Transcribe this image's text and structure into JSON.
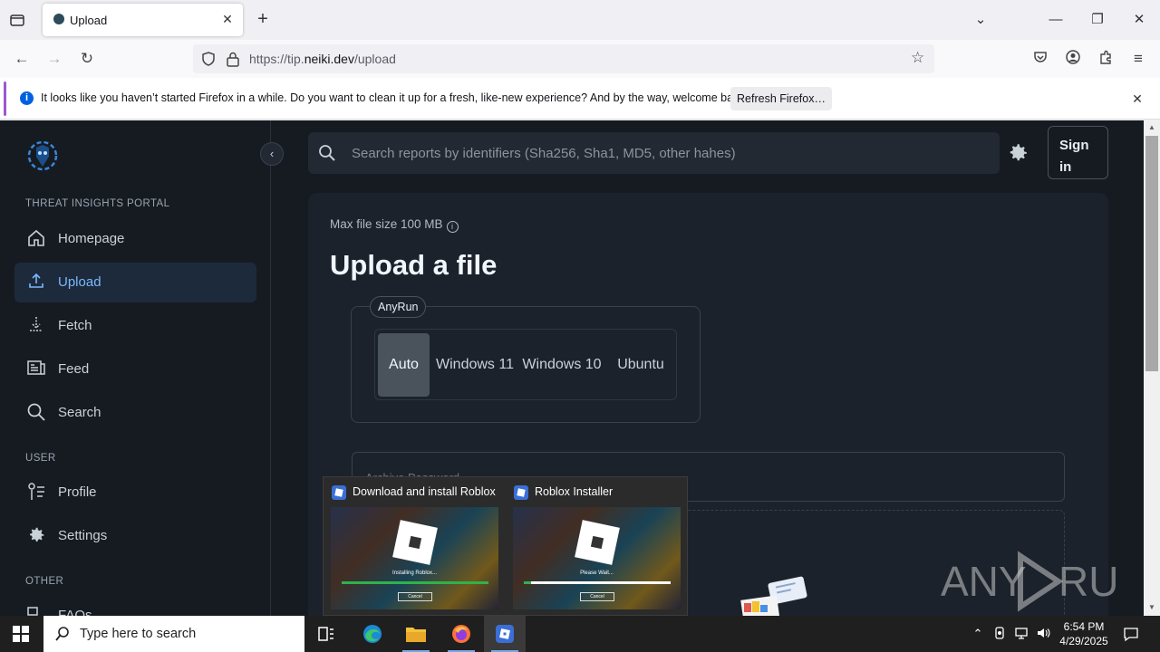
{
  "browser": {
    "tab_title": "Upload",
    "url_prefix": "https://tip.",
    "url_domain": "neiki.dev",
    "url_path": "/upload",
    "notification": {
      "message": "It looks like you haven’t started Firefox in a while. Do you want to clean it up for a fresh, like-new experience? And by the way, welcome back!",
      "button": "Refresh Firefox…"
    }
  },
  "sidebar": {
    "section_portal": "THREAT INSIGHTS PORTAL",
    "section_user": "USER",
    "section_other": "OTHER",
    "items": [
      {
        "label": "Homepage",
        "icon": "home-icon"
      },
      {
        "label": "Upload",
        "icon": "upload-icon"
      },
      {
        "label": "Fetch",
        "icon": "fetch-icon"
      },
      {
        "label": "Feed",
        "icon": "feed-icon"
      },
      {
        "label": "Search",
        "icon": "search-icon"
      },
      {
        "label": "Profile",
        "icon": "profile-icon"
      },
      {
        "label": "Settings",
        "icon": "gear-icon"
      },
      {
        "label": "FAQs",
        "icon": "faq-icon"
      }
    ],
    "active_item": "Upload"
  },
  "header": {
    "search_placeholder": "Search reports by identifiers (Sha256, Sha1, MD5, other hahes)",
    "sign_in": "Sign in"
  },
  "upload": {
    "max_size": "Max file size 100 MB",
    "title": "Upload a file",
    "sandbox_legend": "AnyRun",
    "os_options": [
      "Auto",
      "Windows 11",
      "Windows 10",
      "Ubuntu"
    ],
    "os_selected": "Auto",
    "archive_password_placeholder": "Archive Password"
  },
  "taskbar_preview": [
    {
      "title": "Download and install Roblox",
      "status": "Installing Roblox...",
      "button": "Cancel",
      "progress": 1.0
    },
    {
      "title": "Roblox Installer",
      "status": "Please Wait...",
      "button": "Cancel",
      "progress": 0.05
    }
  ],
  "taskbar": {
    "search_placeholder": "Type here to search",
    "time": "6:54 PM",
    "date": "4/29/2025"
  },
  "watermark": "ANY RUN",
  "colors": {
    "page_bg": "#161b22",
    "card_bg": "#1c222b",
    "active_nav": "#1d2a3b",
    "accent_blue": "#79b8ff",
    "firefox_info": "#0060df"
  }
}
